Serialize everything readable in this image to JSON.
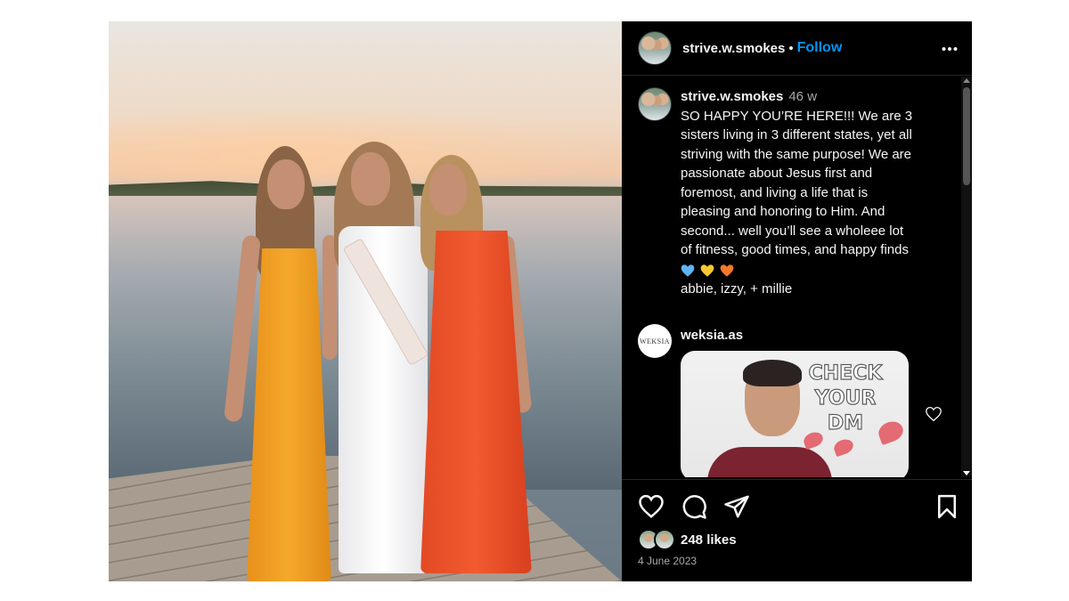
{
  "post": {
    "header": {
      "username": "strive.w.smokes",
      "separator": "•",
      "follow_label": "Follow",
      "more_label": "•••"
    },
    "caption": {
      "username": "strive.w.smokes",
      "time": "46 w",
      "lines": [
        "SO HAPPY YOU’RE HERE!!! We are 3",
        "sisters living in 3 different states, yet all",
        "striving with the same purpose! We are",
        "passionate about Jesus first and",
        "foremost, and living a life that is",
        "pleasing and honoring to Him. And",
        "second... well you’ll see a wholeee lot",
        "of fitness, good times, and happy finds"
      ],
      "emoji_colors": [
        "#5fb3f4",
        "#f7c830",
        "#f4772a"
      ],
      "signoff": "abbie, izzy, + millie"
    },
    "comment": {
      "avatar_text": "WEKSIA",
      "username": "weksia.as",
      "ad_text": "CHECK YOUR DM"
    },
    "actions": {
      "likes": "248 likes",
      "date": "4 June 2023"
    }
  },
  "colors": {
    "accent": "#0095f6",
    "panel_bg": "#000000",
    "text": "#f5f5f5",
    "muted": "#a8a8a8"
  },
  "icons": [
    "more-options-icon",
    "like-icon",
    "comment-icon",
    "share-icon",
    "save-icon",
    "comment-like-icon"
  ]
}
